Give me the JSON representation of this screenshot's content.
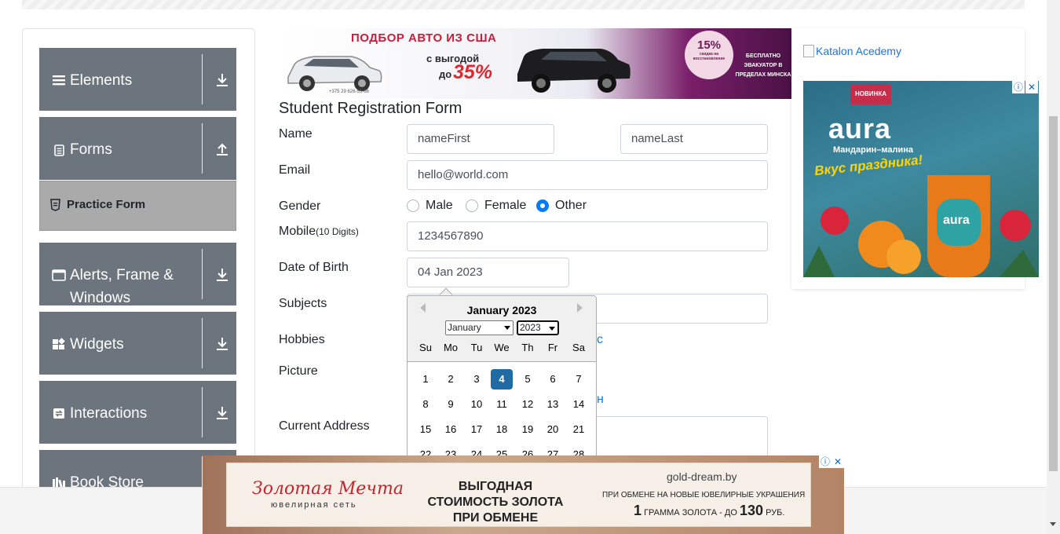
{
  "sidebar": {
    "groups": [
      {
        "label": "Elements",
        "icon": "hamburger-icon"
      },
      {
        "label": "Forms",
        "icon": "document-icon"
      },
      {
        "label": "Alerts, Frame & Windows",
        "icon": "window-icon"
      },
      {
        "label": "Widgets",
        "icon": "widgets-icon"
      },
      {
        "label": "Interactions",
        "icon": "interactions-icon"
      },
      {
        "label": "Book Store",
        "icon": "bookstore-icon"
      }
    ],
    "active_item": "Practice Form"
  },
  "top_banner": {
    "title": "ПОДБОР АВТО ИЗ  США",
    "line1": "с выгодой",
    "line2": "до",
    "percent": "35%",
    "badge_percent": "15%",
    "badge_text": "скидка на восстановление",
    "right_text": "БЕСПЛАТНО ЭВАКУАТОР В ПРЕДЕЛАХ МИНСКА",
    "site": "+375 29 626-55-66"
  },
  "form": {
    "title": "Student Registration Form",
    "name_label": "Name",
    "first_name": "nameFirst",
    "last_name": "nameLast",
    "email_label": "Email",
    "email": "hello@world.com",
    "gender_label": "Gender",
    "gender_options": [
      "Male",
      "Female",
      "Other"
    ],
    "gender_selected": "Other",
    "mobile_label": "Mobile",
    "mobile_hint": "(10 Digits)",
    "mobile": "1234567890",
    "dob_label": "Date of Birth",
    "dob": "04 Jan 2023",
    "subjects_label": "Subjects",
    "hobbies_label": "Hobbies",
    "hobbies_peek": "c",
    "picture_label": "Picture",
    "picture_peek": "н",
    "address_label": "Current Address"
  },
  "datepicker": {
    "title": "January 2023",
    "month": "January",
    "year": "2023",
    "weekdays": [
      "Su",
      "Mo",
      "Tu",
      "We",
      "Th",
      "Fr",
      "Sa"
    ],
    "weeks": [
      [
        "1",
        "2",
        "3",
        "4",
        "5",
        "6",
        "7"
      ],
      [
        "8",
        "9",
        "10",
        "11",
        "12",
        "13",
        "14"
      ],
      [
        "15",
        "16",
        "17",
        "18",
        "19",
        "20",
        "21"
      ],
      [
        "22",
        "23",
        "24",
        "25",
        "26",
        "27",
        "28"
      ]
    ],
    "selected_day": "4"
  },
  "right_ad": {
    "katalon": "Katalon Acedemy",
    "badge": "НОВИНКА",
    "brand": "aura",
    "flavor": "Мандарин–малина",
    "slogan": "Вкус праздника!",
    "info_icon": "info-icon",
    "close_icon": "close-icon"
  },
  "bottom_ad": {
    "brand": "Золотая Мечта",
    "brand_sub": "ювелирная сеть",
    "headline": "ВЫГОДНАЯ СТОИМОСТЬ ЗОЛОТА ПРИ ОБМЕНЕ",
    "site": "gold-dream.by",
    "line1": "ПРИ ОБМЕНЕ НА НОВЫЕ ЮВЕЛИРНЫЕ УКРАШЕНИЯ",
    "line2_a": "1",
    "line2_b": "ГРАММА ЗОЛОТА - ДО",
    "line2_c": "130",
    "line2_d": "РУБ."
  },
  "colors": {
    "sidebar_group": "#6c757d",
    "sidebar_active": "#aaaaaa",
    "datepicker_selected": "#216ba5",
    "radio_checked": "#007bff"
  }
}
